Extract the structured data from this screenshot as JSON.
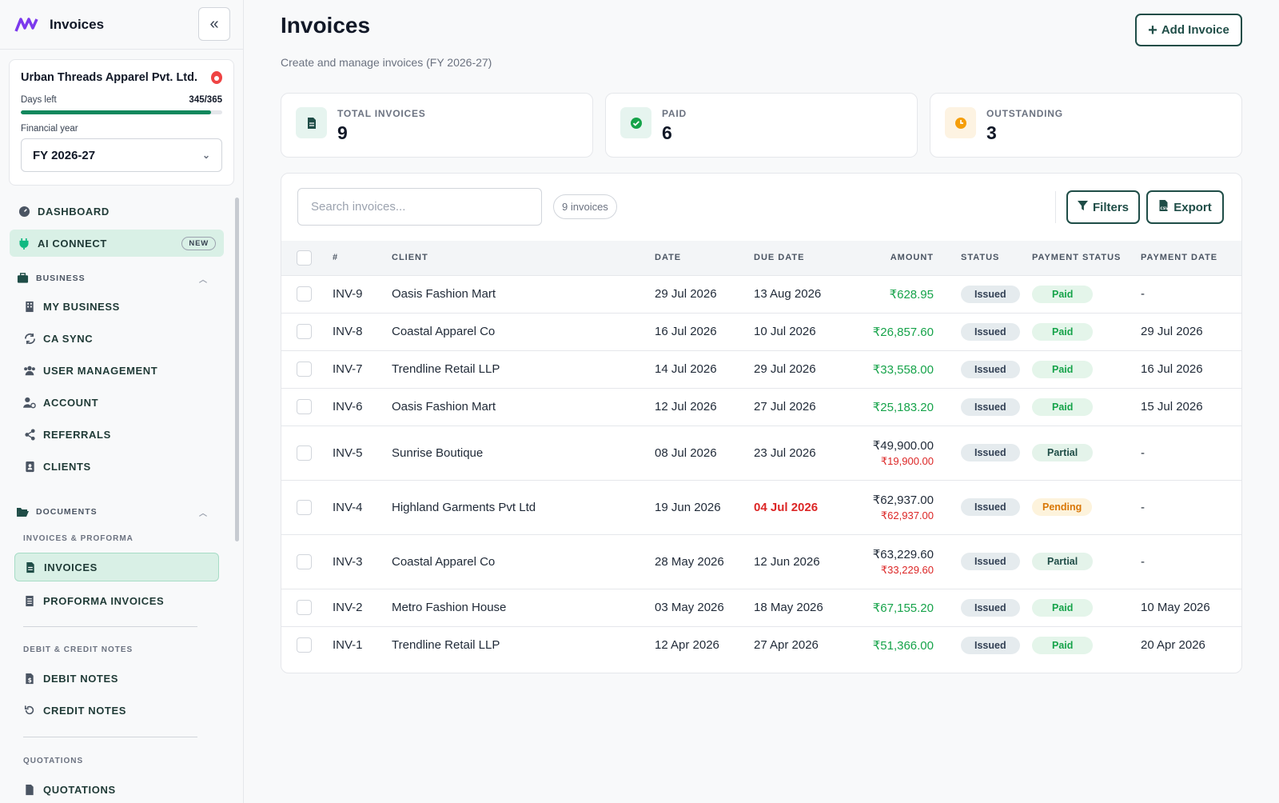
{
  "app": {
    "title": "Invoices"
  },
  "org": {
    "name": "Urban Threads Apparel Pvt. Ltd.",
    "days_left_label": "Days left",
    "days_left_value": "345/365",
    "days_fraction": 0.945,
    "fy_label": "Financial year",
    "fy_value": "FY 2026-27"
  },
  "nav": {
    "dashboard": "DASHBOARD",
    "ai_connect": "AI CONNECT",
    "new_badge": "NEW",
    "business_header": "BUSINESS",
    "business_items": [
      "MY BUSINESS",
      "CA SYNC",
      "USER MANAGEMENT",
      "ACCOUNT",
      "REFERRALS",
      "CLIENTS"
    ],
    "documents_header": "DOCUMENTS",
    "invoices_proforma_header": "INVOICES & PROFORMA",
    "invoices": "INVOICES",
    "proforma": "PROFORMA INVOICES",
    "debit_credit_header": "DEBIT & CREDIT NOTES",
    "debit_notes": "DEBIT NOTES",
    "credit_notes": "CREDIT NOTES",
    "quotations_header": "QUOTATIONS",
    "quotations": "QUOTATIONS"
  },
  "page": {
    "title": "Invoices",
    "subtitle": "Create and manage invoices (FY 2026-27)",
    "add_button": "Add Invoice"
  },
  "stats": [
    {
      "label": "TOTAL INVOICES",
      "value": "9",
      "color": "#e6f4ef",
      "icon": "document-icon"
    },
    {
      "label": "PAID",
      "value": "6",
      "color": "#e6f4ef",
      "icon": "check-circle-icon"
    },
    {
      "label": "OUTSTANDING",
      "value": "3",
      "color": "#fdf3e2",
      "icon": "clock-icon"
    }
  ],
  "toolbar": {
    "search_placeholder": "Search invoices...",
    "count": "9 invoices",
    "filters": "Filters",
    "export": "Export"
  },
  "table": {
    "headers": [
      "#",
      "CLIENT",
      "DATE",
      "DUE DATE",
      "AMOUNT",
      "STATUS",
      "PAYMENT STATUS",
      "PAYMENT DATE"
    ],
    "rows": [
      {
        "id": "INV-9",
        "client": "Oasis Fashion Mart",
        "date": "29 Jul 2026",
        "due": "13 Aug 2026",
        "due_overdue": false,
        "amount": "₹628.95",
        "amount_due": "",
        "status": "Issued",
        "payment_status": "Paid",
        "payment_date": "-"
      },
      {
        "id": "INV-8",
        "client": "Coastal Apparel Co",
        "date": "16 Jul 2026",
        "due": "10 Jul 2026",
        "due_overdue": false,
        "amount": "₹26,857.60",
        "amount_due": "",
        "status": "Issued",
        "payment_status": "Paid",
        "payment_date": "29 Jul 2026"
      },
      {
        "id": "INV-7",
        "client": "Trendline Retail LLP",
        "date": "14 Jul 2026",
        "due": "29 Jul 2026",
        "due_overdue": false,
        "amount": "₹33,558.00",
        "amount_due": "",
        "status": "Issued",
        "payment_status": "Paid",
        "payment_date": "16 Jul 2026"
      },
      {
        "id": "INV-6",
        "client": "Oasis Fashion Mart",
        "date": "12 Jul 2026",
        "due": "27 Jul 2026",
        "due_overdue": false,
        "amount": "₹25,183.20",
        "amount_due": "",
        "status": "Issued",
        "payment_status": "Paid",
        "payment_date": "15 Jul 2026"
      },
      {
        "id": "INV-5",
        "client": "Sunrise Boutique",
        "date": "08 Jul 2026",
        "due": "23 Jul 2026",
        "due_overdue": false,
        "amount": "₹49,900.00",
        "amount_due": "₹19,900.00",
        "status": "Issued",
        "payment_status": "Partial",
        "payment_date": "-"
      },
      {
        "id": "INV-4",
        "client": "Highland Garments Pvt Ltd",
        "date": "19 Jun 2026",
        "due": "04 Jul 2026",
        "due_overdue": true,
        "amount": "₹62,937.00",
        "amount_due": "₹62,937.00",
        "status": "Issued",
        "payment_status": "Pending",
        "payment_date": "-"
      },
      {
        "id": "INV-3",
        "client": "Coastal Apparel Co",
        "date": "28 May 2026",
        "due": "12 Jun 2026",
        "due_overdue": false,
        "amount": "₹63,229.60",
        "amount_due": "₹33,229.60",
        "status": "Issued",
        "payment_status": "Partial",
        "payment_date": "-"
      },
      {
        "id": "INV-2",
        "client": "Metro Fashion House",
        "date": "03 May 2026",
        "due": "18 May 2026",
        "due_overdue": false,
        "amount": "₹67,155.20",
        "amount_due": "",
        "status": "Issued",
        "payment_status": "Paid",
        "payment_date": "10 May 2026"
      },
      {
        "id": "INV-1",
        "client": "Trendline Retail LLP",
        "date": "12 Apr 2026",
        "due": "27 Apr 2026",
        "due_overdue": false,
        "amount": "₹51,366.00",
        "amount_due": "",
        "status": "Issued",
        "payment_status": "Paid",
        "payment_date": "20 Apr 2026"
      }
    ]
  }
}
